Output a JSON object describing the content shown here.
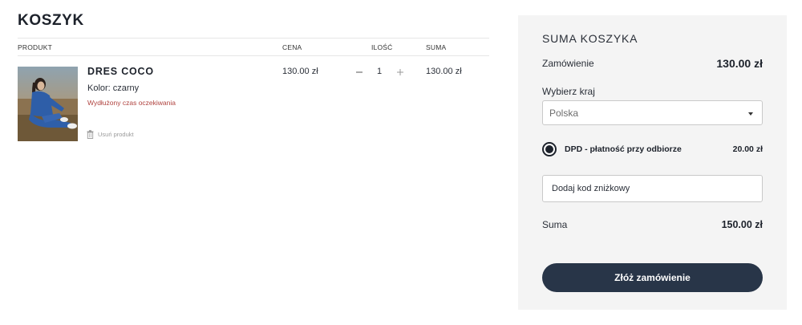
{
  "page": {
    "title": "KOSZYK"
  },
  "cart_table": {
    "headers": {
      "product": "PRODUKT",
      "price": "CENA",
      "quantity": "ILOŚĆ",
      "total": "SUMA"
    },
    "items": [
      {
        "name": "DRES COCO",
        "color_label": "Kolor:",
        "color_value": "czarny",
        "warning": "Wydłużony czas oczekiwania",
        "remove_label": "Usuń produkt",
        "price": "130.00 zł",
        "quantity": "1",
        "line_total": "130.00 zł"
      }
    ]
  },
  "summary": {
    "title": "SUMA KOSZYKA",
    "order_label": "Zamówienie",
    "order_value": "130.00 zł",
    "country_label": "Wybierz kraj",
    "country_selected": "Polska",
    "shipping_label": "DPD - płatność przy odbiorze",
    "shipping_price": "20.00 zł",
    "discount_placeholder": "Dodaj kod zniżkowy",
    "sum_label": "Suma",
    "sum_value": "150.00 zł",
    "checkout_label": "Złóż zamówienie"
  },
  "icons": {
    "trash": "trash-icon",
    "minus": "minus-icon",
    "plus": "plus-icon",
    "caret": "caret-down-icon"
  },
  "colors": {
    "button": "#283548",
    "warning": "#b0433f",
    "summary_bg": "#f4f4f4"
  }
}
